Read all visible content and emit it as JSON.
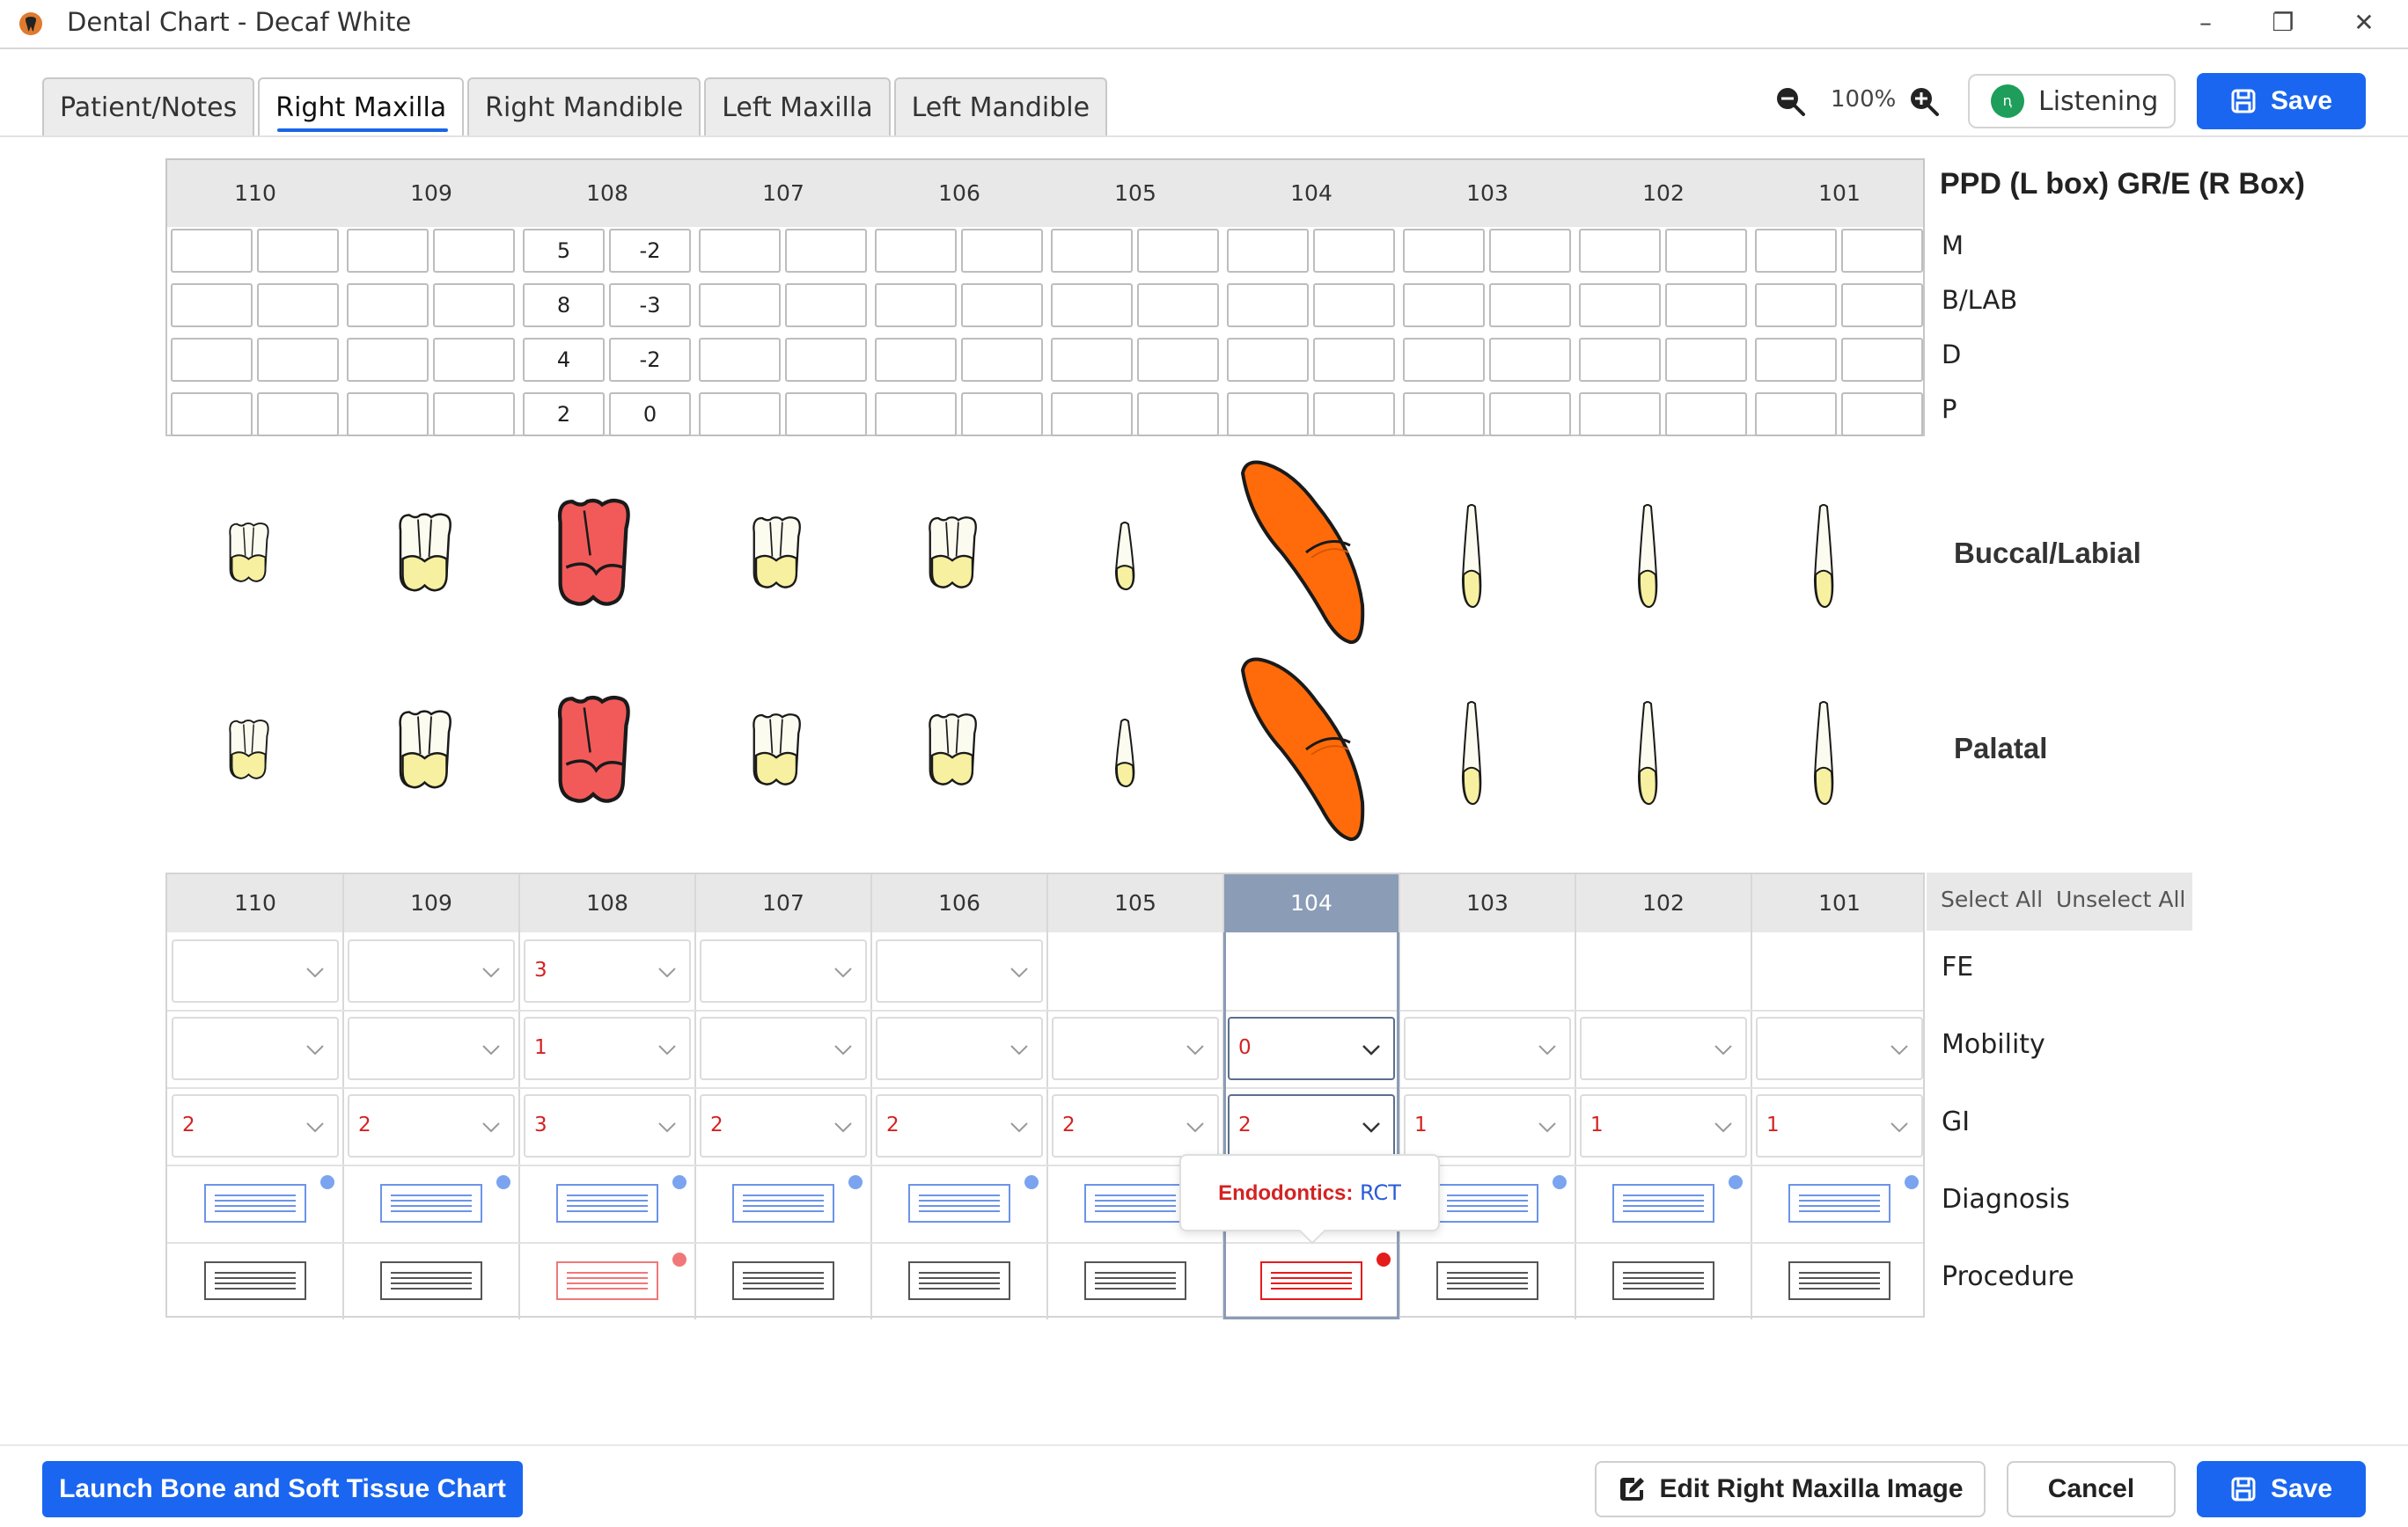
{
  "window": {
    "title": "Dental Chart - Decaf White",
    "app_icon": "tooth-logo-icon",
    "controls": [
      "minimize-icon",
      "restore-icon",
      "close-icon"
    ],
    "minimize": "–",
    "restore": "❐",
    "close": "✕"
  },
  "tabs": [
    {
      "label": "Patient/Notes",
      "active": false
    },
    {
      "label": "Right Maxilla",
      "active": true
    },
    {
      "label": "Right Mandible",
      "active": false
    },
    {
      "label": "Left Maxilla",
      "active": false
    },
    {
      "label": "Left Mandible",
      "active": false
    }
  ],
  "toolbar": {
    "zoom_out_icon": "zoom-out-icon",
    "zoom_level": "100%",
    "zoom_in_icon": "zoom-in-icon",
    "listening_label": "Listening",
    "save_label": "Save"
  },
  "teeth": [
    "110",
    "109",
    "108",
    "107",
    "106",
    "105",
    "104",
    "103",
    "102",
    "101"
  ],
  "ppd": {
    "title": "PPD (L box)  GR/E (R Box)",
    "rows": [
      "M",
      "B/LAB",
      "D",
      "P"
    ],
    "values": {
      "108": [
        [
          "5",
          "-2"
        ],
        [
          "8",
          "-3"
        ],
        [
          "4",
          "-2"
        ],
        [
          "2",
          "0"
        ]
      ]
    }
  },
  "tooth_views": {
    "buccal_label": "Buccal/Labial",
    "palatal_label": "Palatal",
    "colors": {
      "normal_crown": "#f6f0a0",
      "normal_root": "#fbfbf0",
      "extraction": "#f25a5a",
      "endodontic": "#ff6b0a",
      "outline": "#1a1a1a"
    },
    "status": {
      "108": "extraction",
      "104": "endodontic"
    }
  },
  "grid": {
    "selected_tooth": "104",
    "select_all": "Select All",
    "unselect_all": "Unselect All",
    "rows": [
      "FE",
      "Mobility",
      "GI",
      "Diagnosis",
      "Procedure"
    ],
    "fe": [
      "",
      "",
      "3",
      "",
      "",
      null,
      null,
      null,
      null,
      null
    ],
    "mobility": [
      "",
      "",
      "1",
      "",
      "",
      "",
      "0",
      "",
      "",
      ""
    ],
    "gi": [
      "2",
      "2",
      "3",
      "2",
      "2",
      "2",
      "2",
      "1",
      "1",
      "1"
    ],
    "diagnosis_icon": "diagnosis-note-icon",
    "procedure_icon": "procedure-note-icon",
    "procedure_flagged": [
      "108",
      "104"
    ],
    "colors": {
      "value_red": "#d42222",
      "diag_blue": "#6c94e8",
      "dot_blue": "#7aa4f0",
      "dot_red_soft": "#f07878",
      "dot_red": "#e41c1c",
      "selected_header": "#8b9cb6",
      "accent": "#1a66f0"
    }
  },
  "tooltip": {
    "key": "Endodontics:",
    "value": "RCT"
  },
  "footer": {
    "launch_label": "Launch Bone and Soft Tissue Chart",
    "edit_label": "Edit Right Maxilla Image",
    "cancel_label": "Cancel",
    "save_label": "Save"
  }
}
